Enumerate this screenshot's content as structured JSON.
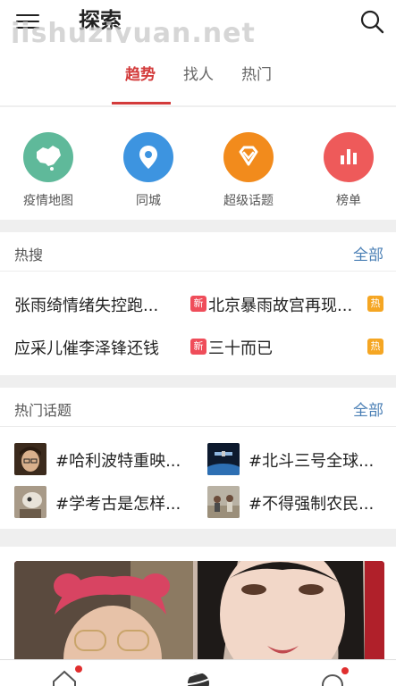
{
  "header": {
    "title": "探索",
    "watermark": "jishuziyuan.net",
    "menu_icon": "menu-icon",
    "search_icon": "search-icon"
  },
  "tabs": [
    {
      "label": "趋势",
      "active": true
    },
    {
      "label": "找人",
      "active": false
    },
    {
      "label": "热门",
      "active": false
    }
  ],
  "shortcuts": [
    {
      "label": "疫情地图",
      "icon": "map-icon",
      "color": "#5fb99a"
    },
    {
      "label": "同城",
      "icon": "location-pin-icon",
      "color": "#3d94e0"
    },
    {
      "label": "超级话题",
      "icon": "diamond-icon",
      "color": "#f28b1c"
    },
    {
      "label": "榜单",
      "icon": "bar-chart-icon",
      "color": "#ee5a5a"
    }
  ],
  "hot_search": {
    "title": "热搜",
    "more": "全部",
    "items": [
      {
        "text": "张雨绮情绪失控跑...",
        "badge": "新",
        "badge_color": "#ef4d5a"
      },
      {
        "text": "北京暴雨故宫再现...",
        "badge": "热",
        "badge_color": "#f5a623"
      },
      {
        "text": "应采儿催李泽锋还钱",
        "badge": "新",
        "badge_color": "#ef4d5a"
      },
      {
        "text": "三十而已",
        "badge": "热",
        "badge_color": "#f5a623"
      }
    ]
  },
  "hot_topics": {
    "title": "热门话题",
    "more": "全部",
    "items": [
      {
        "text": "#哈利波特重映...",
        "thumb": "harry-potter-thumbnail"
      },
      {
        "text": "#北斗三号全球...",
        "thumb": "satellite-thumbnail"
      },
      {
        "text": "#学考古是怎样...",
        "thumb": "archaeology-thumbnail"
      },
      {
        "text": "#不得强制农民...",
        "thumb": "farmers-thumbnail"
      }
    ]
  },
  "bottom_nav": [
    {
      "icon": "home-icon",
      "has_dot": true
    },
    {
      "icon": "discover-planet-icon",
      "has_dot": false
    },
    {
      "icon": "message-icon",
      "has_dot": true
    }
  ],
  "colors": {
    "accent": "#d33b3b",
    "link": "#4a7fb5"
  }
}
